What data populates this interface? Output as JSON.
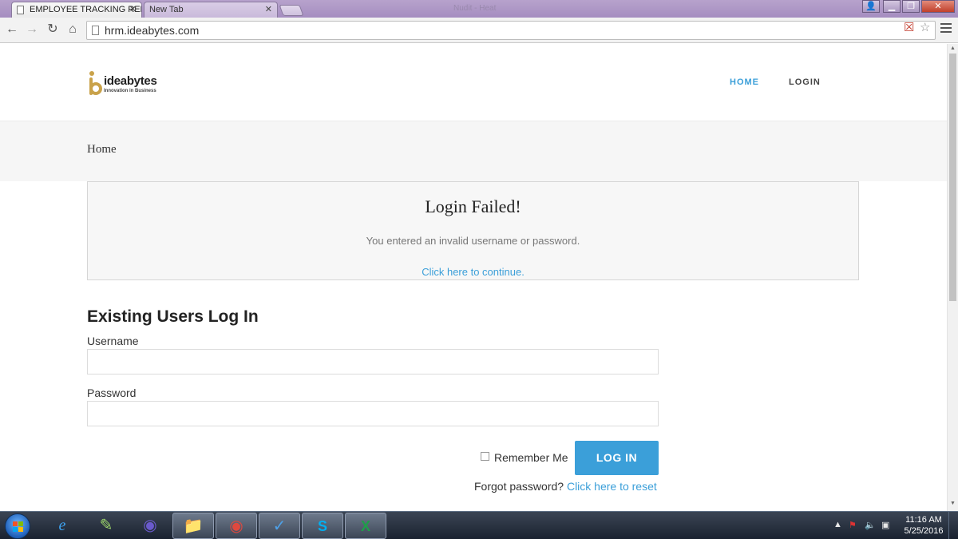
{
  "browser": {
    "tabs": [
      {
        "label": "EMPLOYEE TRACKING REPO",
        "close": "✕"
      },
      {
        "label": "New Tab",
        "close": "✕"
      }
    ],
    "title_ghost": "Nudit - Heat",
    "url": "hrm.ideabytes.com",
    "window_buttons": {
      "user": "👤",
      "minimize": "▁",
      "restore": "❐",
      "close": "✕"
    }
  },
  "site": {
    "logo_text": "ideabytes",
    "logo_tagline": "Innovation in Business",
    "nav": {
      "home": "HOME",
      "login": "LOGIN"
    },
    "accent_color": "#3b9fd9",
    "brand_color": "#c9a24a"
  },
  "breadcrumb": "Home",
  "alert": {
    "title": "Login Failed!",
    "message": "You entered an invalid username or password.",
    "link": "Click here to continue."
  },
  "login_form": {
    "heading": "Existing Users Log In",
    "username_label": "Username",
    "username_value": "",
    "password_label": "Password",
    "password_value": "",
    "remember_label": "Remember Me",
    "remember_checked": false,
    "submit_label": "LOG IN",
    "forgot_text": "Forgot password?",
    "reset_link": "Click here to reset"
  },
  "taskbar": {
    "apps": [
      "internet-explorer",
      "notepad",
      "eclipse",
      "file-explorer",
      "chrome",
      "git-tool",
      "skype",
      "excel"
    ],
    "clock_time": "11:16 AM",
    "clock_date": "5/25/2016"
  }
}
